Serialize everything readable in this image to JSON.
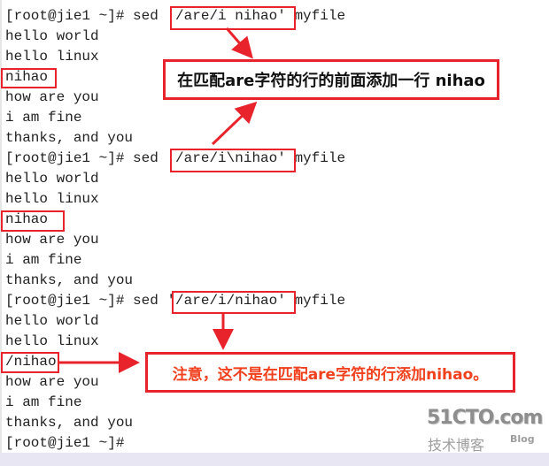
{
  "terminal": {
    "lines": [
      "[root@jie1 ~]# sed '/are/i nihao' myfile",
      "hello world",
      "hello linux",
      "nihao",
      "how are you",
      "i am fine",
      "thanks, and you",
      "[root@jie1 ~]# sed '/are/i\\nihao' myfile",
      "hello world",
      "hello linux",
      "nihao",
      "how are you",
      "i am fine",
      "thanks, and you",
      "[root@jie1 ~]# sed '/are/i/nihao' myfile",
      "hello world",
      "hello linux",
      "/nihao",
      "how are you",
      "i am fine",
      "thanks, and you",
      "[root@jie1 ~]#"
    ]
  },
  "annotations": {
    "callout_1": "在匹配are字符的行的前面添加一行 nihao",
    "callout_2": "注意，这不是在匹配are字符的行添加nihao。",
    "callout_1_color": "#111111",
    "callout_2_color": "#f0401e",
    "accent_color": "#e8232b"
  },
  "watermark": {
    "brand": "51CTO.com",
    "subtitle": "技术博客",
    "blog": "Blog"
  }
}
